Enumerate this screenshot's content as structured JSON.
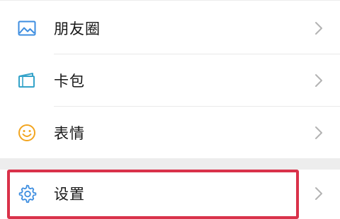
{
  "menu": {
    "items": [
      {
        "label": "朋友圈",
        "icon": "photo-icon",
        "icon_color": "#3e8ee0"
      },
      {
        "label": "卡包",
        "icon": "card-wallet-icon",
        "icon_color": "#35a3c9"
      },
      {
        "label": "表情",
        "icon": "smiley-icon",
        "icon_color": "#f2a520"
      },
      {
        "label": "设置",
        "icon": "gear-icon",
        "icon_color": "#3e8ee0"
      }
    ],
    "highlighted_item": "设置",
    "highlight_color": "#d9324a"
  }
}
